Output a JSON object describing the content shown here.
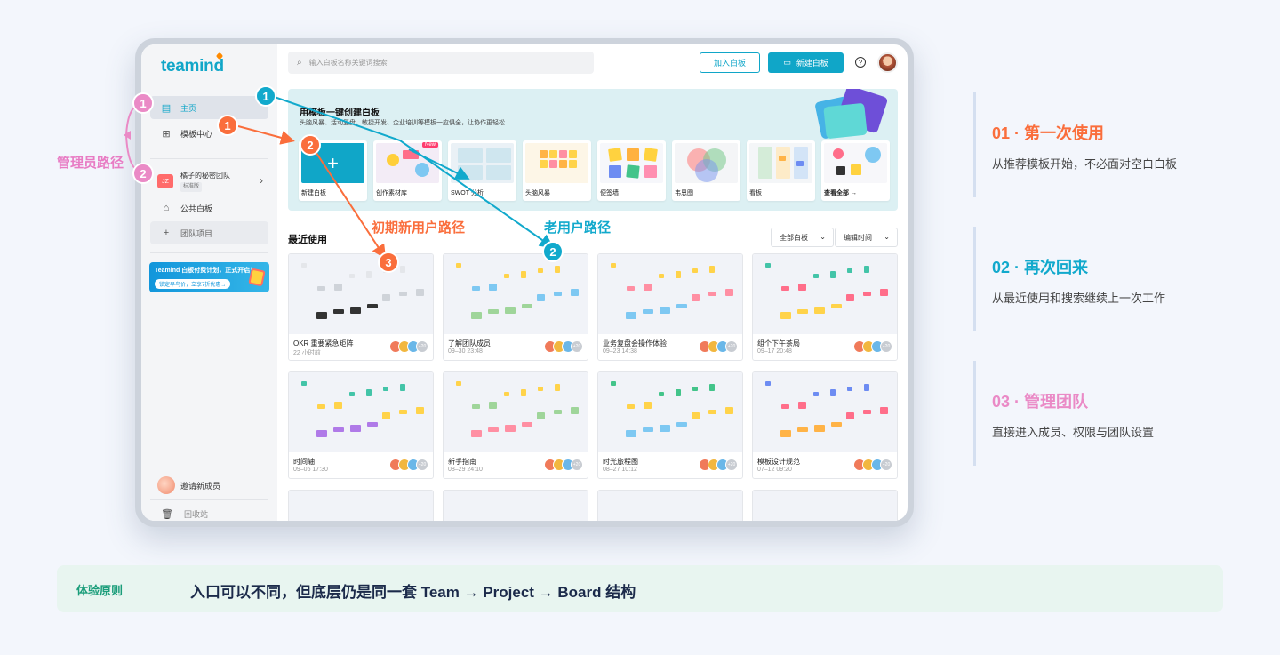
{
  "app": {
    "logo": "teamind"
  },
  "sidebar": {
    "items": [
      {
        "label": "主页",
        "icon": "home-board-icon"
      },
      {
        "label": "模板中心",
        "icon": "template-icon"
      }
    ],
    "team": {
      "avatar": "JZ",
      "name": "橘子的秘密团队",
      "tag": "标准版"
    },
    "public_label": "公共白板",
    "project_label": "团队项目",
    "promo": {
      "title": "Teamind 白板付费计划，正式开启！",
      "cta": "锁定早鸟价，立享7折优惠→"
    },
    "invite_label": "邀请新成员",
    "trash_label": "回收站"
  },
  "toolbar": {
    "search_placeholder": "输入白板名称关键词搜索",
    "join_label": "加入白板",
    "new_label": "新建白板",
    "help_label": "?"
  },
  "banner": {
    "title": "用模板一键创建白板",
    "subtitle": "头脑风暴、活动复盘、敏捷开发、企业培训等模板一应俱全，让协作更轻松",
    "new_tag": "New",
    "templates": [
      {
        "label": "新建白板"
      },
      {
        "label": "创作素材库"
      },
      {
        "label": "SWOT 分析"
      },
      {
        "label": "头脑风暴"
      },
      {
        "label": "便签墙"
      },
      {
        "label": "韦恩图"
      },
      {
        "label": "看板"
      },
      {
        "label": "查看全部 →"
      }
    ]
  },
  "recent": {
    "title": "最近使用",
    "filter_all": "全部白板",
    "filter_time": "编辑时间",
    "more_count": "+20",
    "boards": [
      {
        "name": "OKR 重要紧急矩阵",
        "time": "22 小时前"
      },
      {
        "name": "了解团队成员",
        "time": "09–30 23:48"
      },
      {
        "name": "业务复盘会操作体验",
        "time": "09–23 14:38"
      },
      {
        "name": "组个下午茶局",
        "time": "09–17 20:48"
      },
      {
        "name": "时间轴",
        "time": "09–06 17:30"
      },
      {
        "name": "新手指南",
        "time": "08–29 24:10"
      },
      {
        "name": "时光旅程图",
        "time": "08–27 10:12"
      },
      {
        "name": "模板设计规范",
        "time": "07–12 09:20"
      }
    ]
  },
  "annotations": {
    "admin_path": "管理员路径",
    "new_user_path": "初期新用户路径",
    "old_user_path": "老用户路径",
    "n1": "1",
    "n2": "2",
    "n3": "3"
  },
  "steps": [
    {
      "num": "01",
      "sep": "·",
      "title": "第一次使用",
      "desc": "从推荐模板开始，不必面对空白白板",
      "color": "#fa6e3c"
    },
    {
      "num": "02",
      "sep": "·",
      "title": "再次回来",
      "desc": "从最近使用和搜索继续上一次工作",
      "color": "#11a9cc"
    },
    {
      "num": "03",
      "sep": "·",
      "title": "管理团队",
      "desc": "直接进入成员、权限与团队设置",
      "color": "#ea8ac6"
    }
  ],
  "principle": {
    "label": "体验原则",
    "text": "入口可以不同，但底层仍是同一套 Team → Project → Board 结构"
  },
  "colors": {
    "brand": "#10a6c8",
    "orange": "#fa6e3c",
    "blue": "#11a9cc",
    "pink": "#ea8ac6"
  }
}
